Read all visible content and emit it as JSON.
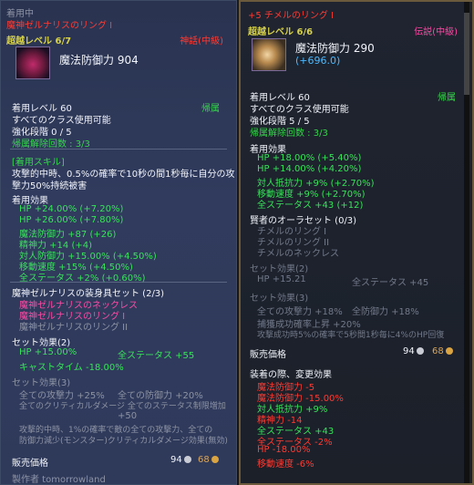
{
  "left": {
    "equipped_label": "着用中",
    "title": "魔神ゼルナリスのリング I",
    "grade_line": "超越レベル 6/7",
    "grade_label": "神話(中級)",
    "main_stat": "魔法防御力 904",
    "level_line": "着用レベル 60",
    "bind_label": "帰属",
    "class_line": "すべてのクラス使用可能",
    "enhance_line": "強化段階 0 / 5",
    "unbind_line": "帰属解除回数 : 3/3",
    "skill_header": "[着用スキル]",
    "skill_desc_1": "攻撃的中時、0.5%の確率で10秒の間1秒毎に自分の攻",
    "skill_desc_2": "撃力50%持続被害",
    "effects_header": "着用効果",
    "effects": [
      "HP +24.00% (+7.20%)",
      "HP +26.00% (+7.80%)",
      "魔法防御力 +87 (+26)",
      "精神力 +14 (+4)",
      "対人防御力 +15.00% (+4.50%)",
      "移動速度 +15% (+4.50%)",
      "全ステータス +2% (+0.60%)"
    ],
    "set_title": "魔神ゼルナリスの装身具セット (2/3)",
    "set_items": [
      "魔神ゼルナリスのネックレス",
      "魔神ゼルナリスのリング I",
      "魔神ゼルナリスのリング II"
    ],
    "set2_header": "セット効果(2)",
    "set2_line1_left": "HP +15.00%",
    "set2_line1_right": "全ステータス +55",
    "set2_line2": "キャストタイム -18.00%",
    "set3_header": "セット効果(3)",
    "set3_line1_left": "全ての攻撃力 +25%",
    "set3_line1_right": "全ての防御力 +20%",
    "set3_line2": "全てのクリティカルダメージ 全てのステータス制限増加",
    "set3_line3": "+50",
    "set3_line4": "攻撃的中時、1%の確率で敵の全ての攻撃力、全ての",
    "set3_line5": "防御力減少(モンスター)クリティカルダメージ効果(無効)",
    "price_label": "販売価格",
    "price_silver": "94",
    "price_gold": "68",
    "maker_line": "製作者 tomorrowland"
  },
  "right": {
    "title": "+5 チメルのリング I",
    "grade_line": "超越レベル 6/6",
    "grade_label": "伝説(中級)",
    "main_stat": "魔法防御力 290",
    "main_bonus": "(+696.0)",
    "level_line": "着用レベル 60",
    "bind_label": "帰属",
    "class_line": "すべてのクラス使用可能",
    "enhance_line": "強化段階 5 / 5",
    "unbind_line": "帰属解除回数 : 3/3",
    "effects_header": "着用効果",
    "effects": [
      "HP +18.00% (+5.40%)",
      "HP +14.00% (+4.20%)",
      "対人抵抗力 +9% (+2.70%)",
      "移動速度 +9% (+2.70%)",
      "全ステータス +43 (+12)"
    ],
    "aura_header": "賢者のオーラセット (0/3)",
    "aura_items": [
      "チメルのリング I",
      "チメルのリング II",
      "チメルのネックレス"
    ],
    "set2_header": "セット効果(2)",
    "set2_left": "HP +15.21",
    "set2_right": "全ステータス +45",
    "set3_header": "セット効果(3)",
    "set3_line1_left": "全ての攻撃力 +18%",
    "set3_line1_right": "全防御力 +18%",
    "set3_line2": "捕獲成功確率上昇 +20%",
    "set3_line3": "攻撃成功時5%の確率で5秒間1秒毎に4%のHP回復",
    "price_label": "販売価格",
    "price_silver": "94",
    "price_gold": "68",
    "change_header": "装着の際、変更効果",
    "changes": [
      {
        "text": "魔法防御力 -5",
        "color": "red"
      },
      {
        "text": "魔法防御力 -15.00%",
        "color": "red"
      },
      {
        "text": "対人抵抗力 +9%",
        "color": "green"
      },
      {
        "text": "精神力 -14",
        "color": "red"
      },
      {
        "text": "全ステータス +43",
        "color": "green"
      },
      {
        "text": "全ステータス -2%",
        "color": "red"
      },
      {
        "text": "HP -18.00%",
        "color": "red"
      },
      {
        "text": "移動速度 -6%",
        "color": "red"
      }
    ]
  }
}
